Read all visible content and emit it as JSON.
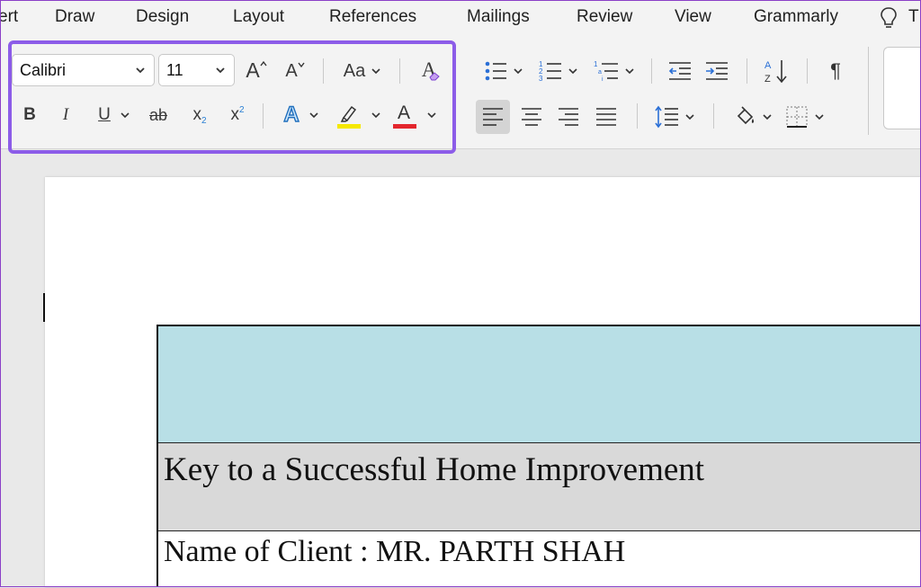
{
  "menu": {
    "tabs": [
      "ert",
      "Draw",
      "Design",
      "Layout",
      "References",
      "Mailings",
      "Review",
      "View",
      "Grammarly"
    ],
    "tell_me": "T"
  },
  "font": {
    "family": "Calibri",
    "size": "11",
    "case_label": "Aa"
  },
  "colors": {
    "highlight_color": "#f5e800",
    "font_color": "#e3262d",
    "table_header_fill": "#b8dfe6",
    "table_title_fill": "#d9d9d9",
    "selection_outline": "#8c5ce8"
  },
  "icons": {
    "paragraph": "¶",
    "bold": "B",
    "italic": "I",
    "underline": "U",
    "strikethrough": "ab",
    "subscript": "x",
    "superscript": "x",
    "subscript_mark": "2",
    "superscript_mark": "2",
    "text_effects": "A",
    "font_color_letter": "A",
    "grow_font": "A",
    "shrink_font": "A",
    "clear_formatting": "A"
  },
  "document": {
    "title": "Key to a Successful Home Improvement",
    "client_line": "Name of Client : MR. PARTH SHAH"
  }
}
